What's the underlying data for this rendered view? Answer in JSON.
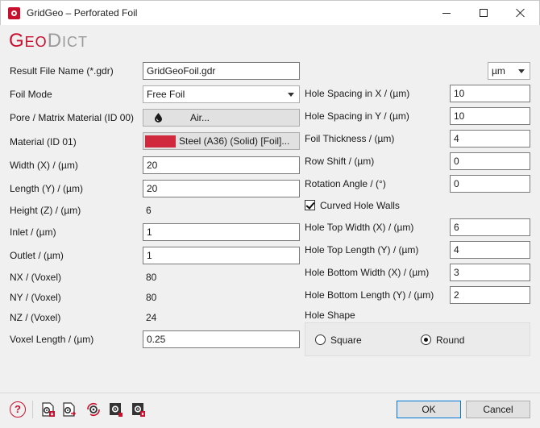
{
  "window": {
    "title": "GridGeo – Perforated Foil"
  },
  "logo": {
    "geo_g": "G",
    "geo_rest": "EO",
    "dict_d": "D",
    "dict_rest": "ICT"
  },
  "unit_select": {
    "value": "µm"
  },
  "left": {
    "result_file": {
      "label": "Result File Name (*.gdr)",
      "value": "GridGeoFoil.gdr"
    },
    "foil_mode": {
      "label": "Foil Mode",
      "value": "Free Foil"
    },
    "pore_material": {
      "label": "Pore / Matrix Material (ID 00)",
      "value": "Air..."
    },
    "material": {
      "label": "Material (ID 01)",
      "value": "Steel (A36) (Solid) [Foil]...",
      "color": "#d0283d"
    },
    "width": {
      "label": "Width (X) / (µm)",
      "value": "20"
    },
    "length": {
      "label": "Length (Y) / (µm)",
      "value": "20"
    },
    "height": {
      "label": "Height (Z) / (µm)",
      "value": "6"
    },
    "inlet": {
      "label": "Inlet / (µm)",
      "value": "1"
    },
    "outlet": {
      "label": "Outlet / (µm)",
      "value": "1"
    },
    "nx": {
      "label": "NX / (Voxel)",
      "value": "80"
    },
    "ny": {
      "label": "NY / (Voxel)",
      "value": "80"
    },
    "nz": {
      "label": "NZ / (Voxel)",
      "value": "24"
    },
    "voxel_length": {
      "label": "Voxel Length / (µm)",
      "value": "0.25"
    }
  },
  "right": {
    "hole_spacing_x": {
      "label": "Hole Spacing in X / (µm)",
      "value": "10"
    },
    "hole_spacing_y": {
      "label": "Hole Spacing in Y / (µm)",
      "value": "10"
    },
    "foil_thickness": {
      "label": "Foil Thickness / (µm)",
      "value": "4"
    },
    "row_shift": {
      "label": "Row Shift / (µm)",
      "value": "0"
    },
    "rotation_angle": {
      "label": "Rotation Angle / (°)",
      "value": "0"
    },
    "curved_walls": {
      "label": "Curved Hole Walls",
      "checked": true
    },
    "hole_top_width": {
      "label": "Hole Top Width (X) / (µm)",
      "value": "6"
    },
    "hole_top_length": {
      "label": "Hole Top Length (Y) / (µm)",
      "value": "4"
    },
    "hole_bottom_width": {
      "label": "Hole Bottom Width (X) / (µm)",
      "value": "3"
    },
    "hole_bottom_length": {
      "label": "Hole Bottom Length (Y) / (µm)",
      "value": "2"
    },
    "hole_shape": {
      "label": "Hole Shape",
      "options": [
        "Square",
        "Round"
      ],
      "selected": "Round"
    }
  },
  "footer": {
    "help": "?",
    "ok": "OK",
    "cancel": "Cancel"
  },
  "colors": {
    "brand": "#c8102e",
    "accent": "#0078d7"
  }
}
